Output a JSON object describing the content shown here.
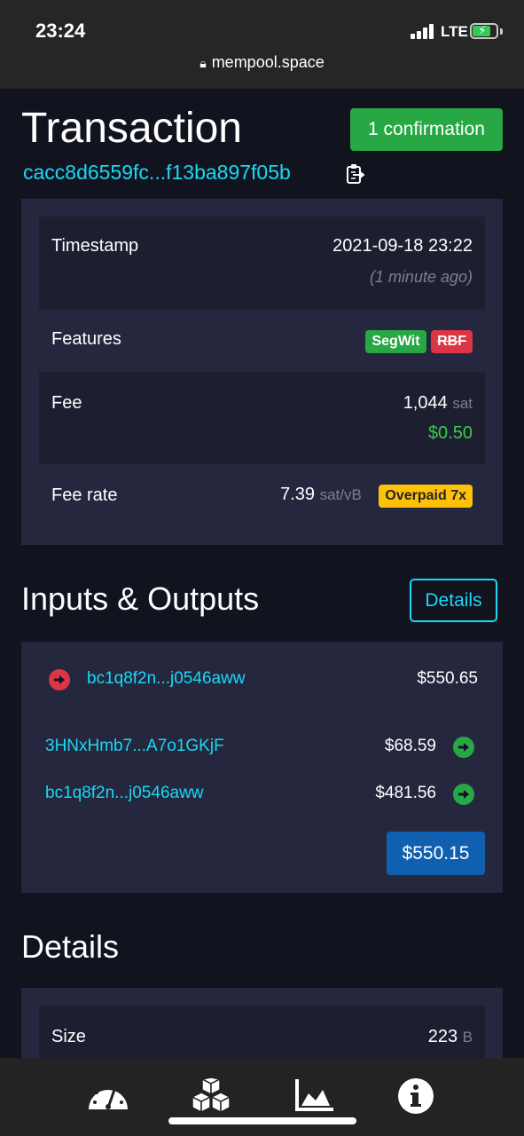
{
  "status_bar": {
    "time": "23:24",
    "network": "LTE"
  },
  "browser": {
    "url": "mempool.space"
  },
  "header": {
    "title": "Transaction",
    "confirmations": "1 confirmation",
    "txid": "cacc8d6559fc...f13ba897f05b"
  },
  "summary": {
    "timestamp_label": "Timestamp",
    "timestamp_value": "2021-09-18 23:22",
    "timestamp_relative": "(1 minute ago)",
    "features_label": "Features",
    "feature_badges": [
      "SegWit",
      "RBF"
    ],
    "fee_label": "Fee",
    "fee_value": "1,044",
    "fee_unit": "sat",
    "fee_fiat": "$0.50",
    "fee_rate_label": "Fee rate",
    "fee_rate_value": "7.39",
    "fee_rate_unit": "sat/vB",
    "overpaid_badge": "Overpaid 7x"
  },
  "io": {
    "title": "Inputs & Outputs",
    "details_button": "Details",
    "inputs": [
      {
        "address": "bc1q8f2n...j0546aww",
        "amount": "$550.65"
      }
    ],
    "outputs": [
      {
        "address": "3HNxHmb7...A7o1GKjF",
        "amount": "$68.59"
      },
      {
        "address": "bc1q8f2n...j0546aww",
        "amount": "$481.56"
      }
    ],
    "total": "$550.15"
  },
  "details": {
    "title": "Details",
    "size_label": "Size",
    "size_value": "223",
    "size_unit": "B"
  },
  "colors": {
    "background": "#11131f",
    "card": "#24273e",
    "link": "#1bd8f4",
    "success": "#28a745",
    "danger": "#dc3545",
    "warning": "#ffc107",
    "primary": "#105fb0"
  },
  "bottom_nav": {
    "icons": [
      "dashboard-gauge-icon",
      "blocks-icon",
      "graphs-chart-icon",
      "info-icon"
    ]
  }
}
